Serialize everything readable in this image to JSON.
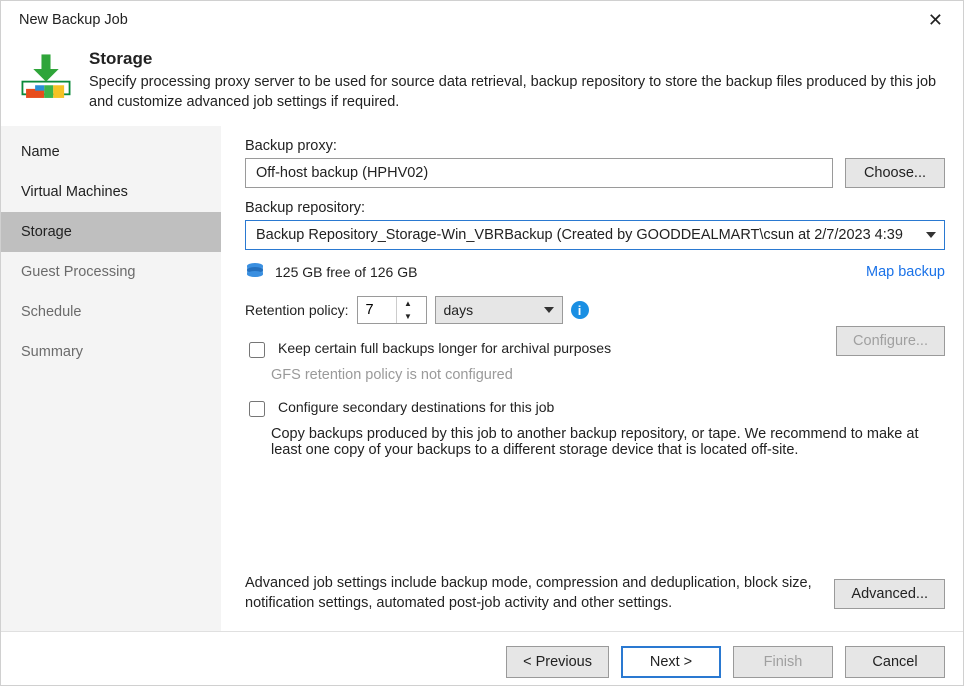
{
  "window": {
    "title": "New Backup Job"
  },
  "header": {
    "title": "Storage",
    "description": "Specify processing proxy server to be used for source data retrieval, backup repository to store the backup files produced by this job and customize advanced job settings if required."
  },
  "sidebar": {
    "items": [
      {
        "label": "Name",
        "active": false
      },
      {
        "label": "Virtual Machines",
        "active": false
      },
      {
        "label": "Storage",
        "active": true
      },
      {
        "label": "Guest Processing",
        "active": false
      },
      {
        "label": "Schedule",
        "active": false
      },
      {
        "label": "Summary",
        "active": false
      }
    ]
  },
  "proxy": {
    "label": "Backup proxy:",
    "value": "Off-host backup (HPHV02)",
    "choose_label": "Choose..."
  },
  "repo": {
    "label": "Backup repository:",
    "value": "Backup Repository_Storage-Win_VBRBackup (Created by GOODDEALMART\\csun at 2/7/2023 4:39",
    "free": "125 GB free of 126 GB",
    "map_backup": "Map backup"
  },
  "retention": {
    "label": "Retention policy:",
    "value": "7",
    "unit": "days"
  },
  "gfs": {
    "checkbox": "Keep certain full backups longer for archival purposes",
    "status": "GFS retention policy is not configured",
    "configure": "Configure..."
  },
  "secondary": {
    "checkbox": "Configure secondary destinations for this job",
    "description": "Copy backups produced by this job to another backup repository, or tape. We recommend to make at least one copy of your backups to a different storage device that is located off-site."
  },
  "advanced": {
    "description": "Advanced job settings include backup mode, compression and deduplication, block size, notification settings, automated post-job activity and other settings.",
    "button": "Advanced..."
  },
  "footer": {
    "previous": "< Previous",
    "next": "Next >",
    "finish": "Finish",
    "cancel": "Cancel"
  }
}
